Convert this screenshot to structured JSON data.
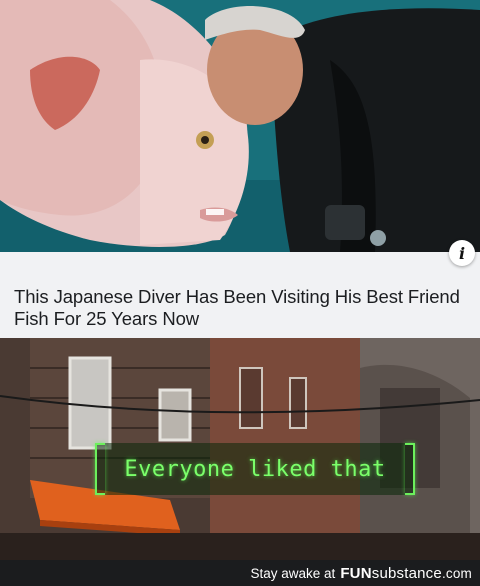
{
  "top_image": {
    "subject": "diver-kissing-fish-photo",
    "info_icon_glyph": "i"
  },
  "headline": {
    "text": "This Japanese Diver Has Been Visiting His Best Friend Fish For 25 Years Now"
  },
  "bottom_image": {
    "subject": "game-street-scene",
    "caption": "Everyone liked that",
    "caption_color": "#7bff6a"
  },
  "footer": {
    "tagline": "Stay awake at",
    "brand_fun": "FUN",
    "brand_sub": "substance",
    "brand_tld": ".com"
  }
}
